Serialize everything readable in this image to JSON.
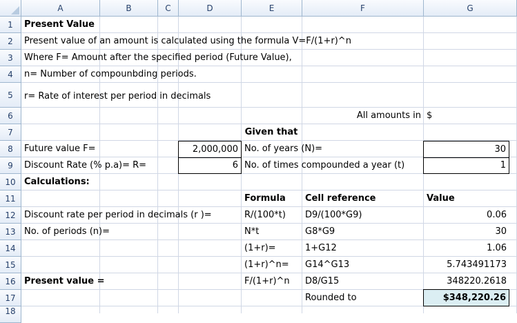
{
  "columns": [
    "A",
    "B",
    "C",
    "D",
    "E",
    "F",
    "G"
  ],
  "rows": [
    "1",
    "2",
    "3",
    "4",
    "5",
    "6",
    "7",
    "8",
    "9",
    "10",
    "11",
    "12",
    "13",
    "14",
    "15",
    "16",
    "17",
    "18"
  ],
  "cells": {
    "a1": "Present Value",
    "a2": "Present value of an amount is calculated using the formula V=F/(1+r)^n",
    "a3": "Where F= Amount after the specified period (Future Value),",
    "a4": "n= Number of compounbding periods.",
    "a5": "r= Rate of interest per period in decimals",
    "f6": "All amounts in",
    "g6": "$",
    "e7": "Given that",
    "a8": "Future value F=",
    "d8": "2,000,000",
    "e8": "No. of years (N)=",
    "g8": "30",
    "a9": "Discount Rate  (% p.a)= R=",
    "d9": "6",
    "e9": "No. of times compounded a year (t)",
    "g9": "1",
    "a10": "Calculations:",
    "e11": "Formula",
    "f11": "Cell reference",
    "g11": "Value",
    "a12": "Discount rate per period in decimals (r )=",
    "e12": "R/(100*t)",
    "f12": "D9/(100*G9)",
    "g12": "0.06",
    "a13": "No. of periods (n)=",
    "e13": "N*t",
    "f13": "G8*G9",
    "g13": "30",
    "e14": "(1+r)=",
    "f14": "1+G12",
    "g14": "1.06",
    "e15": "(1+r)^n=",
    "f15": "G14^G13",
    "g15": "5.743491173",
    "a16": "Present value =",
    "e16": "F/(1+r)^n",
    "f16": "D8/G15",
    "g16": "348220.2618",
    "f17": "Rounded to",
    "g17": "$348,220.26"
  }
}
